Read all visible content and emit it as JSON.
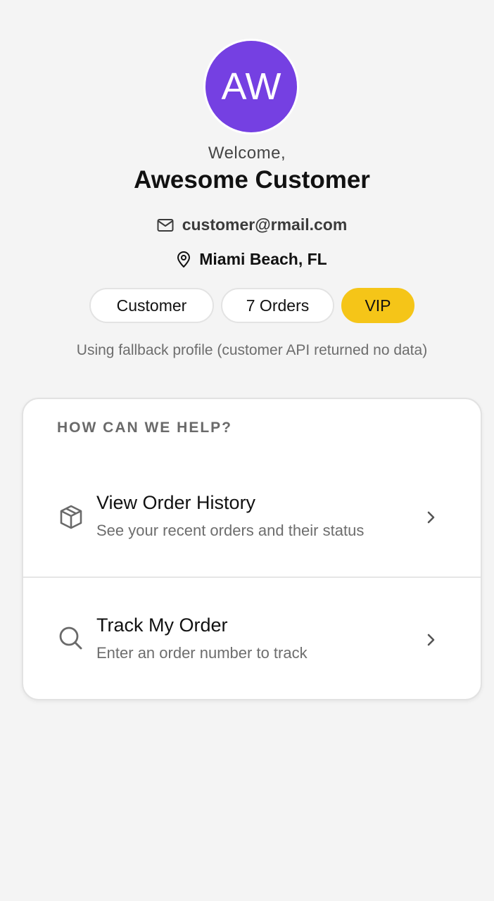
{
  "profile": {
    "initials": "AW",
    "avatar_color": "#7540e2",
    "welcome": "Welcome,",
    "name": "Awesome Customer",
    "email": "customer@rmail.com",
    "email_icon": "mail-icon",
    "location": "Miami Beach, FL",
    "location_icon": "map-pin-icon"
  },
  "chips": {
    "role": "Customer",
    "orders": "7 Orders",
    "tier": "VIP",
    "tier_color": "#f5c518"
  },
  "fallback_notice": "Using fallback profile (customer API returned no data)",
  "help": {
    "title": "HOW CAN WE HELP?",
    "options": [
      {
        "title": "View Order History",
        "subtitle": "See your recent orders and their status",
        "icon": "package-icon"
      },
      {
        "title": "Track My Order",
        "subtitle": "Enter an order number to track",
        "icon": "search-icon"
      }
    ]
  }
}
